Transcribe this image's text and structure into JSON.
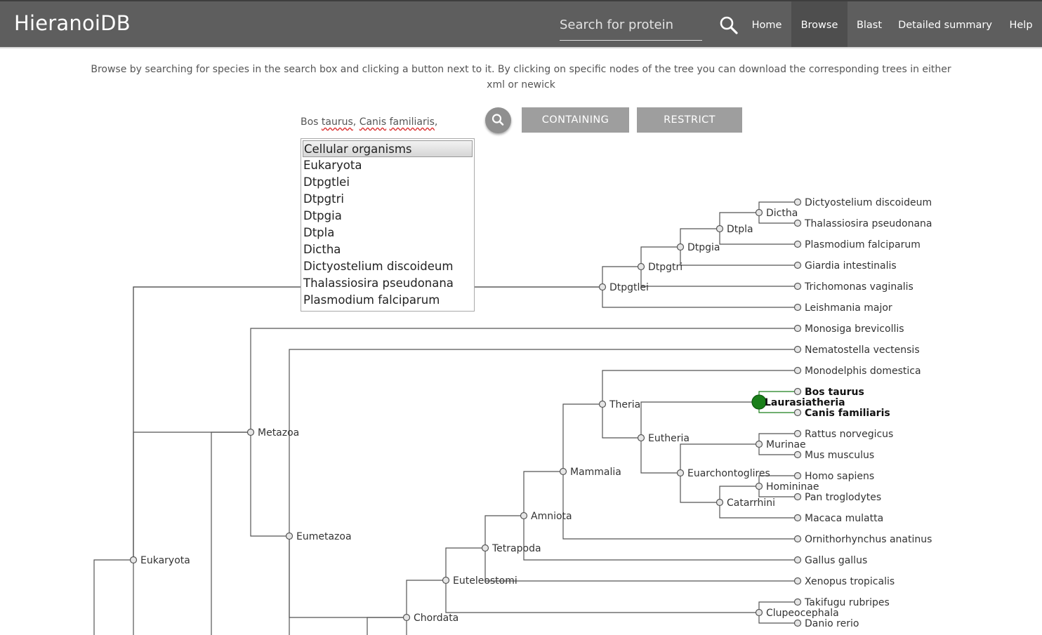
{
  "header": {
    "brand": "HieranoiDB",
    "search_placeholder": "Search for protein",
    "nav": [
      {
        "label": "Home",
        "active": false
      },
      {
        "label": "Browse",
        "active": true
      },
      {
        "label": "Blast",
        "active": false
      },
      {
        "label": "Detailed summary",
        "active": false
      },
      {
        "label": "Help",
        "active": false
      }
    ]
  },
  "description": "Browse by searching for species in the search box and clicking a button next to it. By clicking on specific nodes of the tree you can download the corresponding trees in either xml or newick",
  "species_selection": [
    "Bos taurus",
    "Canis familiaris"
  ],
  "buttons": {
    "containing": "CONTAINING",
    "restrict": "RESTRICT"
  },
  "listbox": {
    "selected": "Cellular organisms",
    "options": [
      "Cellular organisms",
      "Eukaryota",
      "Dtpgtlei",
      "Dtpgtri",
      "Dtpgia",
      "Dtpla",
      "Dictha",
      "Dictyostelium discoideum",
      "Thalassiosira pseudonana",
      "Plasmodium falciparum"
    ]
  },
  "tree": {
    "highlight_color": "#1a7f1a",
    "highlighted_node": "Laurasiatheria",
    "highlighted_leaves": [
      "Bos taurus",
      "Canis familiaris"
    ],
    "internal_nodes": [
      "Eukaryota",
      "Dtpgtlei",
      "Dtpgtri",
      "Dtpgia",
      "Dtpla",
      "Dictha",
      "Metazoa",
      "Eumetazoa",
      "Chordata",
      "Euteleostomi",
      "Tetrapoda",
      "Amniota",
      "Mammalia",
      "Theria",
      "Eutheria",
      "Laurasiatheria",
      "Murinae",
      "Euarchontoglires",
      "Catarrhini",
      "Homininae",
      "Clupeocephala"
    ],
    "leaves": [
      "Dictyostelium discoideum",
      "Thalassiosira pseudonana",
      "Plasmodium falciparum",
      "Giardia intestinalis",
      "Trichomonas vaginalis",
      "Leishmania major",
      "Monosiga brevicollis",
      "Nematostella vectensis",
      "Monodelphis domestica",
      "Bos taurus",
      "Canis familiaris",
      "Rattus norvegicus",
      "Mus musculus",
      "Homo sapiens",
      "Pan troglodytes",
      "Macaca mulatta",
      "Ornithorhynchus anatinus",
      "Gallus gallus",
      "Xenopus tropicalis",
      "Takifugu rubripes",
      "Danio rerio"
    ]
  }
}
